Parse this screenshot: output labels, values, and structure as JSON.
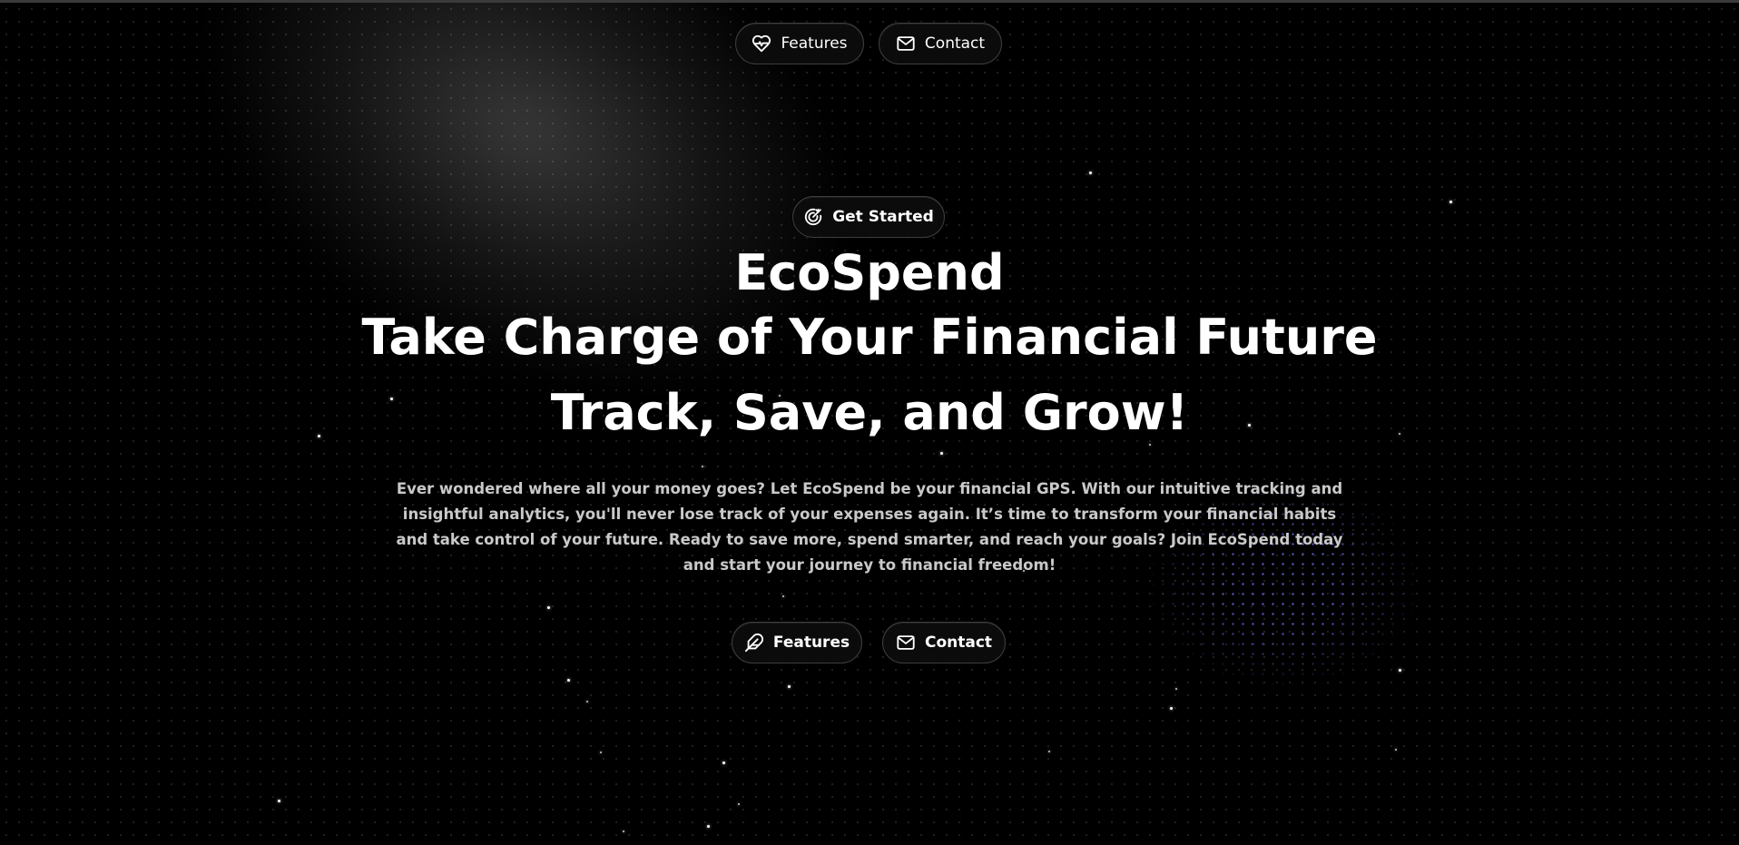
{
  "nav": {
    "features_label": "Features",
    "contact_label": "Contact"
  },
  "hero": {
    "badge_label": "Get Started",
    "title": "EcoSpend",
    "subtitle": "Take Charge of Your Financial Future",
    "tagline": "Track, Save, and Grow!",
    "description": "Ever wondered where all your money goes? Let EcoSpend be your financial GPS. With our intuitive tracking and insightful analytics, you'll never lose track of your expenses again. It’s time to transform your financial habits and take control of your future. Ready to save more, spend smarter, and reach your goals? Join EcoSpend today and start your journey to financial freedom!"
  },
  "cta": {
    "features_label": "Features",
    "contact_label": "Contact"
  },
  "icons": {
    "nav_features": "heart-pulse-icon",
    "nav_contact": "mail-icon",
    "badge": "target-arrow-icon",
    "cta_features": "feather-icon",
    "cta_contact": "mail-icon"
  },
  "colors": {
    "background": "#000000",
    "text": "#ffffff",
    "muted_text": "#c9c9c9",
    "pill_border": "#3e3e3e",
    "accent_dots": "#7878ff"
  }
}
